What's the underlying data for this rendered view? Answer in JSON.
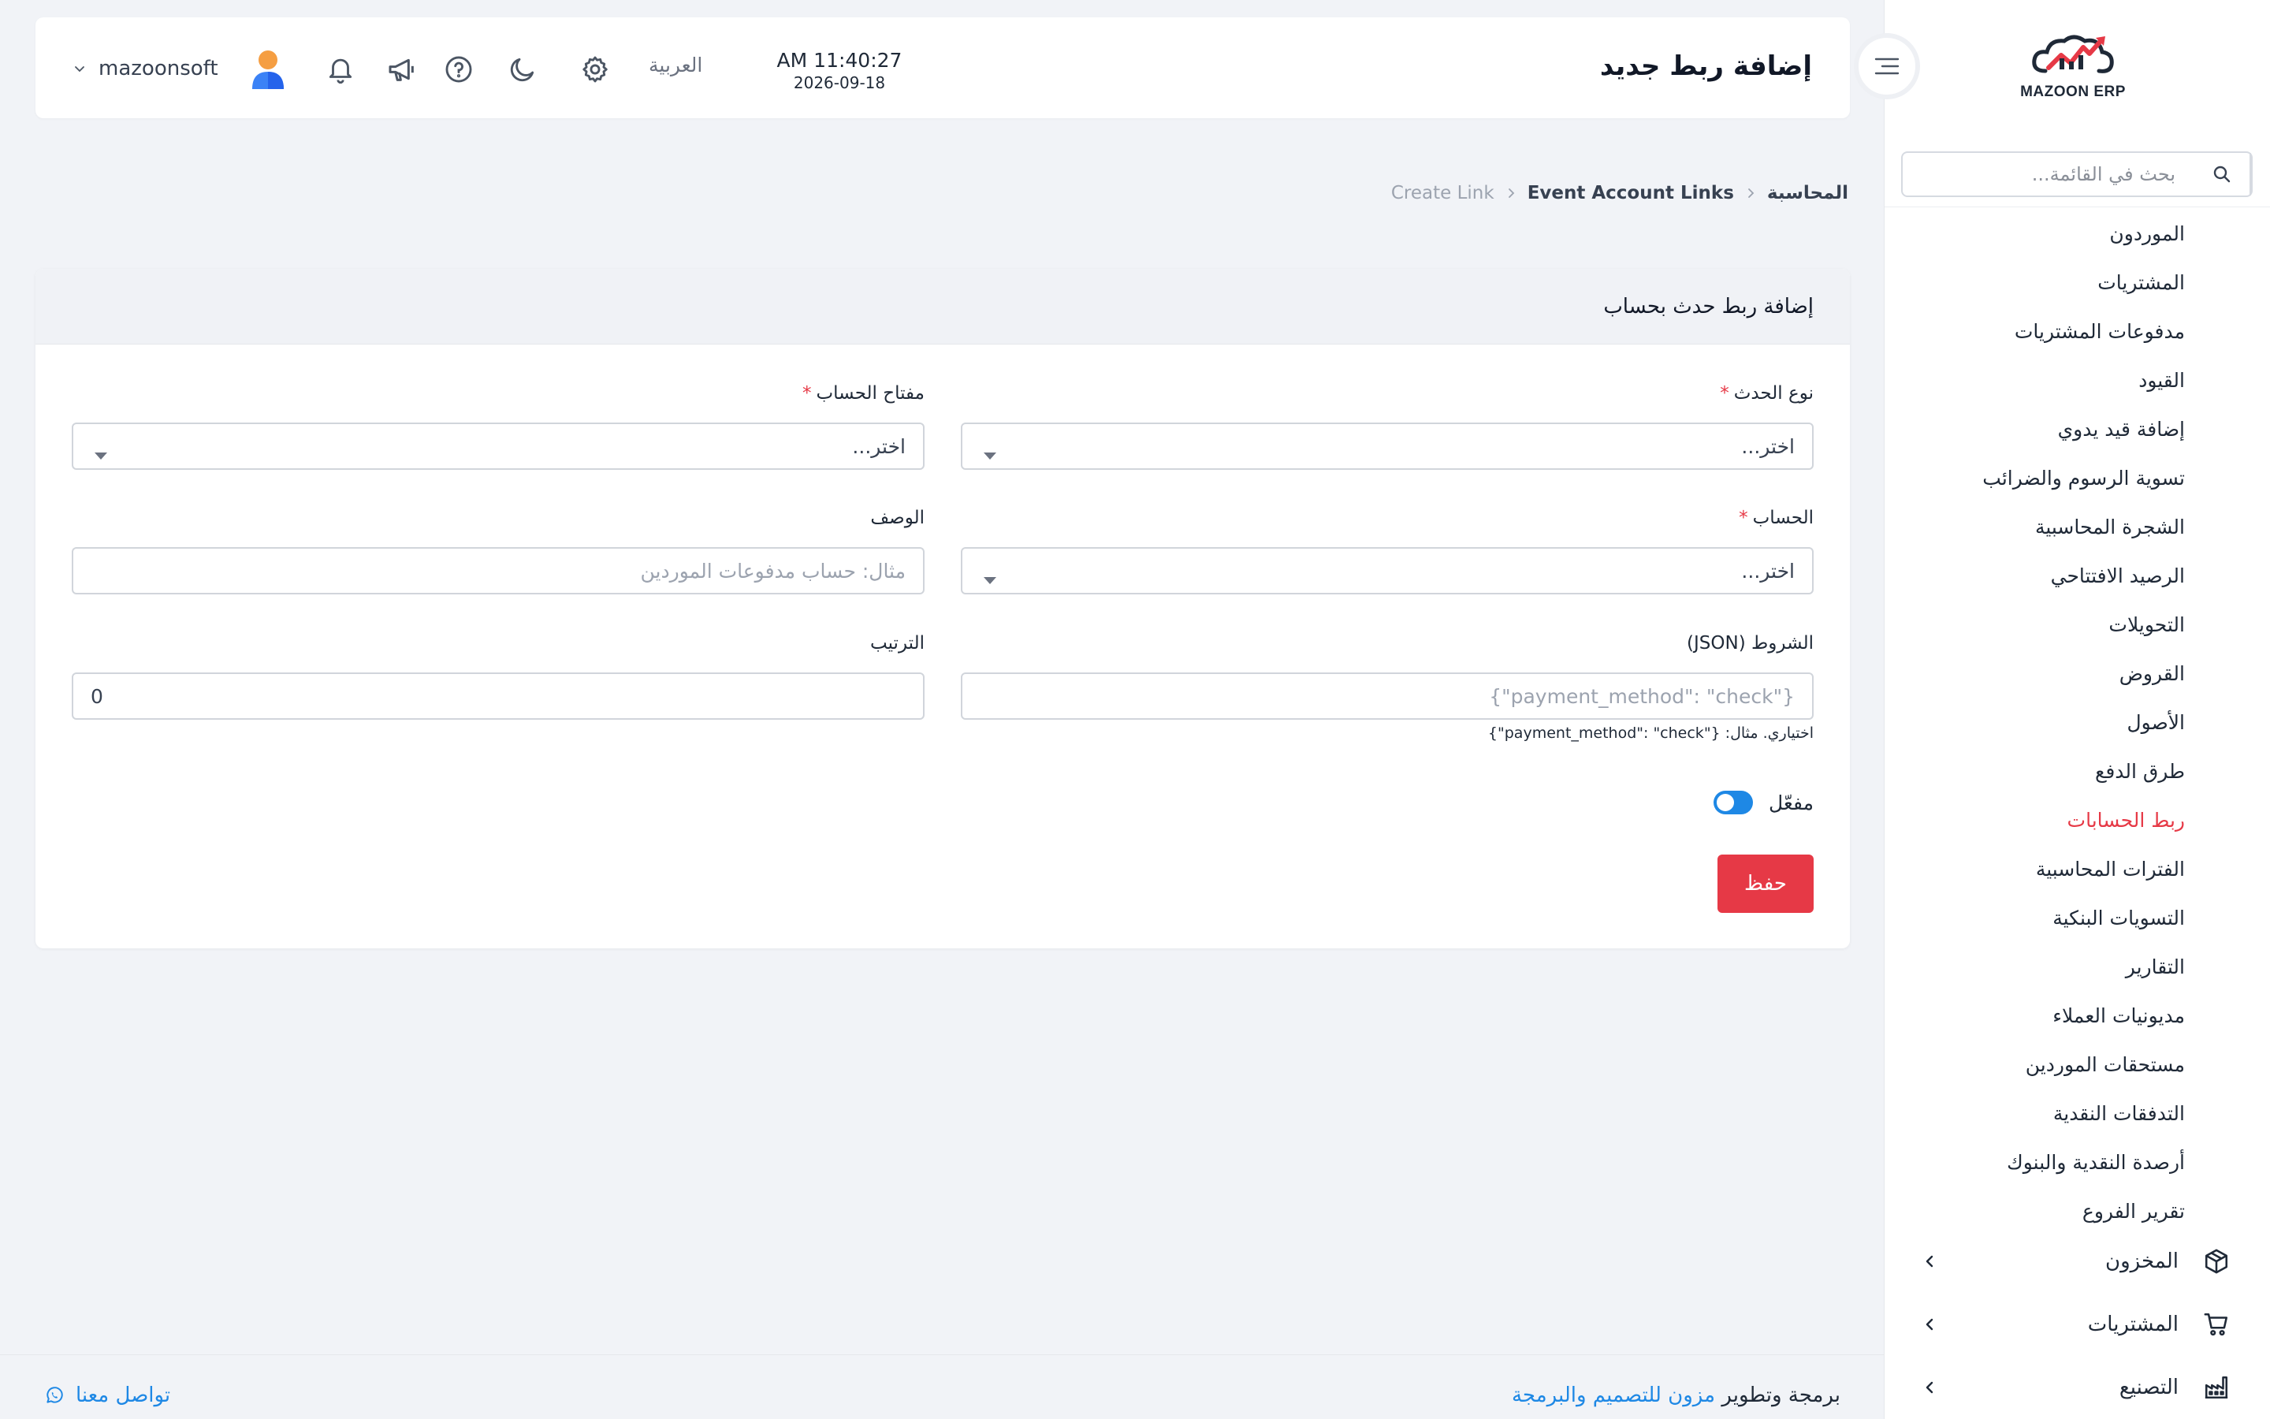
{
  "app": {
    "logo_text": "MAZOON ERP",
    "brand_color": "#e63946",
    "accent_color": "#1e88e5"
  },
  "sidebar": {
    "search_placeholder": "بحث في القائمة...",
    "items": [
      {
        "label": "الموردون"
      },
      {
        "label": "المشتريات"
      },
      {
        "label": "مدفوعات المشتريات"
      },
      {
        "label": "القيود"
      },
      {
        "label": "إضافة قيد يدوي"
      },
      {
        "label": "تسوية الرسوم والضرائب"
      },
      {
        "label": "الشجرة المحاسبية"
      },
      {
        "label": "الرصيد الافتتاحي"
      },
      {
        "label": "التحويلات"
      },
      {
        "label": "القروض"
      },
      {
        "label": "الأصول"
      },
      {
        "label": "طرق الدفع"
      },
      {
        "label": "ربط الحسابات",
        "active": true
      },
      {
        "label": "الفترات المحاسبية"
      },
      {
        "label": "التسويات البنكية"
      },
      {
        "label": "التقارير"
      },
      {
        "label": "مديونيات العملاء"
      },
      {
        "label": "مستحقات الموردين"
      },
      {
        "label": "التدفقات النقدية"
      },
      {
        "label": "أرصدة النقدية والبنوك"
      },
      {
        "label": "تقرير الفروع"
      }
    ],
    "groups": [
      {
        "label": "المخزون",
        "icon": "box-icon"
      },
      {
        "label": "المشتريات",
        "icon": "cart-icon"
      },
      {
        "label": "التصنيع",
        "icon": "factory-icon"
      }
    ]
  },
  "header": {
    "title": "إضافة ربط جديد",
    "time": "AM 11:40:27",
    "date": "2026-09-18",
    "language": "العربية",
    "username": "mazoonsoft"
  },
  "breadcrumb": {
    "root": "المحاسبة",
    "parent": "Event Account Links",
    "current": "Create Link"
  },
  "form": {
    "card_title": "إضافة ربط حدث بحساب",
    "event_type": {
      "label": "نوع الحدث",
      "value": "اختر..."
    },
    "account_key": {
      "label": "مفتاح الحساب",
      "value": "اختر..."
    },
    "account": {
      "label": "الحساب",
      "value": "اختر..."
    },
    "description": {
      "label": "الوصف",
      "placeholder": "مثال: حساب مدفوعات الموردين"
    },
    "conditions": {
      "label": "الشروط (JSON)",
      "placeholder": "{\"payment_method\": \"check\"}",
      "hint": "اختياري. مثال: {\"payment_method\": \"check\"}"
    },
    "order": {
      "label": "الترتيب",
      "value": "0"
    },
    "enabled_label": "مفعّل",
    "save_label": "حفظ"
  },
  "footer": {
    "credit_prefix": "برمجة وتطوير",
    "credit_brand": "مزون للتصميم والبرمجة",
    "contact": "تواصل معنا"
  }
}
